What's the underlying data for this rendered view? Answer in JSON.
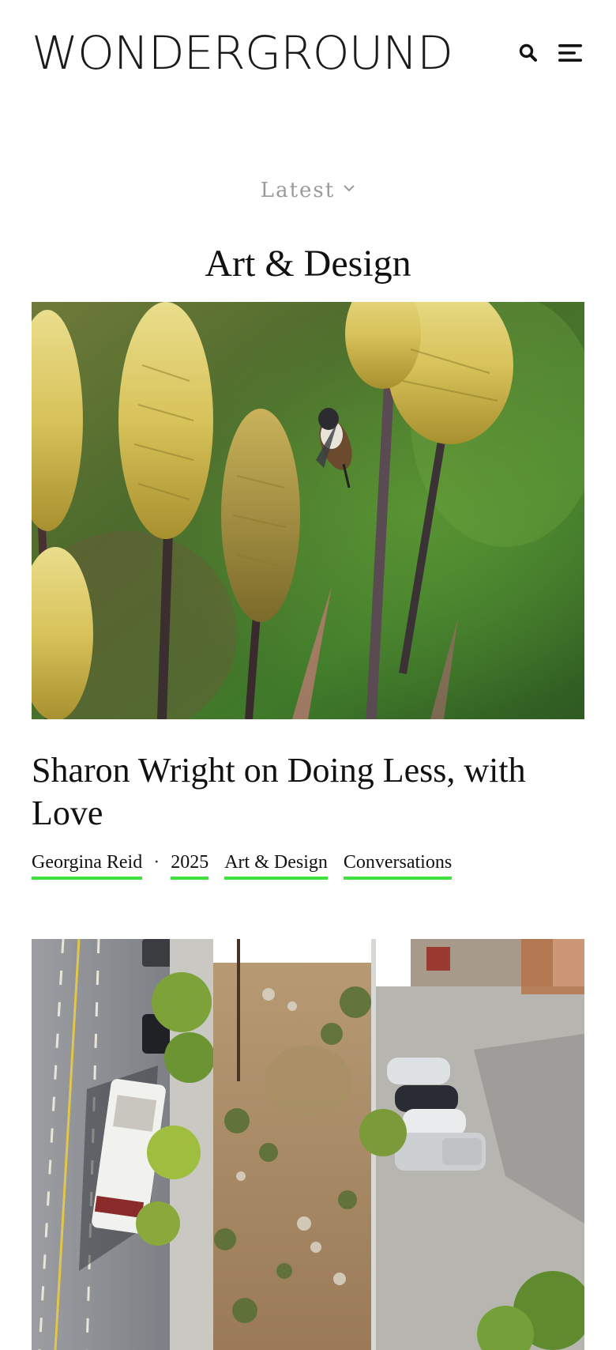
{
  "header": {
    "logo": "WONDERGROUND",
    "search_icon": "search-icon",
    "menu_icon": "hamburger-menu-icon"
  },
  "filter": {
    "label": "Latest",
    "icon": "chevron-down-icon"
  },
  "section": {
    "title": "Art & Design"
  },
  "articles": [
    {
      "title": "Sharon Wright on Doing Less, with Love",
      "author": "Georgina Reid",
      "separator": "·",
      "year": "2025",
      "tags": [
        "Art & Design",
        "Conversations"
      ],
      "image": "hummingbird-on-aloe-flowers-photo"
    },
    {
      "image": "aerial-view-of-garden-lot-photo"
    }
  ],
  "colors": {
    "accent_underline": "#3ee23a",
    "muted_text": "#9a9a9a"
  }
}
